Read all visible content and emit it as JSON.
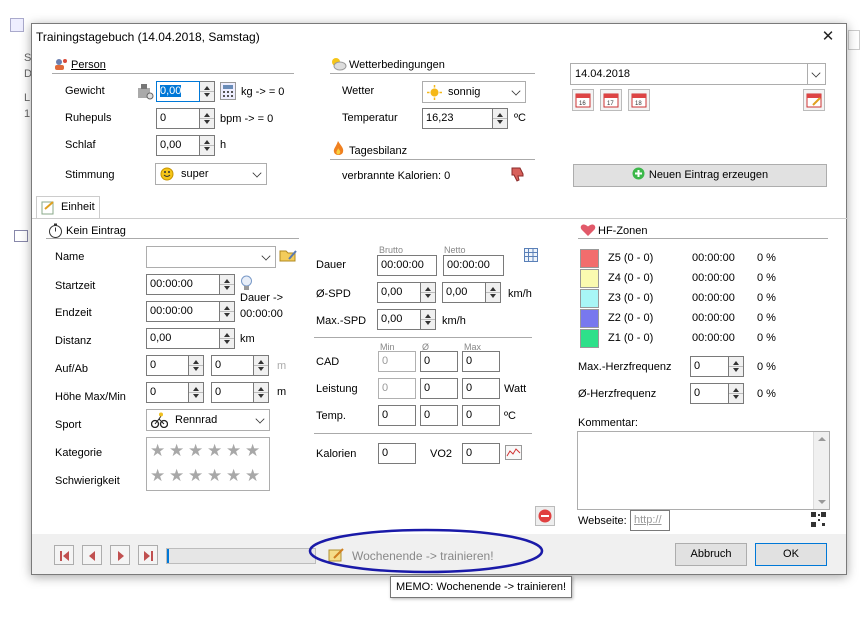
{
  "window": {
    "title": "Trainingstagebuch (14.04.2018, Samstag)"
  },
  "person": {
    "section": "Person",
    "gewicht_label": "Gewicht",
    "gewicht_value": "0,00",
    "gewicht_unit": "kg  -> = 0",
    "ruhepuls_label": "Ruhepuls",
    "ruhepuls_value": "0",
    "ruhepuls_unit": "bpm  -> = 0",
    "schlaf_label": "Schlaf",
    "schlaf_value": "0,00",
    "schlaf_unit": "h",
    "stimmung_label": "Stimmung",
    "stimmung_value": "super"
  },
  "wetter": {
    "section": "Wetterbedingungen",
    "wetter_label": "Wetter",
    "wetter_value": "sonnig",
    "temperatur_label": "Temperatur",
    "temperatur_value": "16,23",
    "temperatur_unit": "ºC"
  },
  "tagesbilanz": {
    "section": "Tagesbilanz",
    "kalorien_text": "verbrannte Kalorien: 0"
  },
  "date": {
    "value": "14.04.2018"
  },
  "new_entry_button": "Neuen Eintrag erzeugen",
  "tab": {
    "label": "Einheit"
  },
  "entry": {
    "section": "Kein Eintrag",
    "name_label": "Name",
    "startzeit_label": "Startzeit",
    "startzeit_value": "00:00:00",
    "endzeit_label": "Endzeit",
    "endzeit_value": "00:00:00",
    "dauer_label": "Dauer ->",
    "dauer_value": "00:00:00",
    "distanz_label": "Distanz",
    "distanz_value": "0,00",
    "distanz_unit": "km",
    "aufab_label": "Auf/Ab",
    "auf_value": "0",
    "ab_value": "0",
    "aufab_unit": "m",
    "hoehe_label": "Höhe Max/Min",
    "hoehe_max": "0",
    "hoehe_min": "0",
    "hoehe_unit": "m",
    "sport_label": "Sport",
    "sport_value": "Rennrad",
    "kategorie_label": "Kategorie",
    "schwierigkeit_label": "Schwierigkeit"
  },
  "metrics": {
    "brutto": "Brutto",
    "netto": "Netto",
    "dauer_label": "Dauer",
    "dauer_brutto": "00:00:00",
    "dauer_netto": "00:00:00",
    "spd_label": "Ø-SPD",
    "spd_brutto": "0,00",
    "spd_netto": "0,00",
    "spd_unit": "km/h",
    "maxspd_label": "Max.-SPD",
    "maxspd_value": "0,00",
    "maxspd_unit": "km/h",
    "min": "Min",
    "avg": "Ø",
    "max": "Max",
    "cad_label": "CAD",
    "cad_min": "0",
    "cad_avg": "0",
    "cad_max": "0",
    "leistung_label": "Leistung",
    "leistung_min": "0",
    "leistung_avg": "0",
    "leistung_max": "0",
    "leistung_unit": "Watt",
    "temp_label": "Temp.",
    "temp_min": "0",
    "temp_avg": "0",
    "temp_max": "0",
    "temp_unit": "ºC",
    "kalorien_label": "Kalorien",
    "kalorien_value": "0",
    "vo2_label": "VO2",
    "vo2_value": "0"
  },
  "hf": {
    "section": "HF-Zonen",
    "zones": [
      {
        "name": "Z5 (0 - 0)",
        "time": "00:00:00",
        "pct": "0 %",
        "color": "#f26d6d"
      },
      {
        "name": "Z4 (0 - 0)",
        "time": "00:00:00",
        "pct": "0 %",
        "color": "#fafab0"
      },
      {
        "name": "Z3 (0 - 0)",
        "time": "00:00:00",
        "pct": "0 %",
        "color": "#a8f6f6"
      },
      {
        "name": "Z2 (0 - 0)",
        "time": "00:00:00",
        "pct": "0 %",
        "color": "#7878ee"
      },
      {
        "name": "Z1 (0 - 0)",
        "time": "00:00:00",
        "pct": "0 %",
        "color": "#2ee08a"
      }
    ],
    "max_label": "Max.-Herzfrequenz",
    "max_value": "0",
    "max_pct": "0 %",
    "avg_label": "Ø-Herzfrequenz",
    "avg_value": "0",
    "avg_pct": "0 %"
  },
  "kommentar": {
    "label": "Kommentar:"
  },
  "webseite": {
    "label": "Webseite:",
    "value": "http://"
  },
  "footer": {
    "memo_text": "Wochenende -> trainieren!",
    "abbruch": "Abbruch",
    "ok": "OK"
  },
  "tooltip": {
    "text": "MEMO: Wochenende -> trainieren!"
  },
  "colors": {
    "accent": "#0078d7",
    "ellipse": "#1a1aa8"
  }
}
